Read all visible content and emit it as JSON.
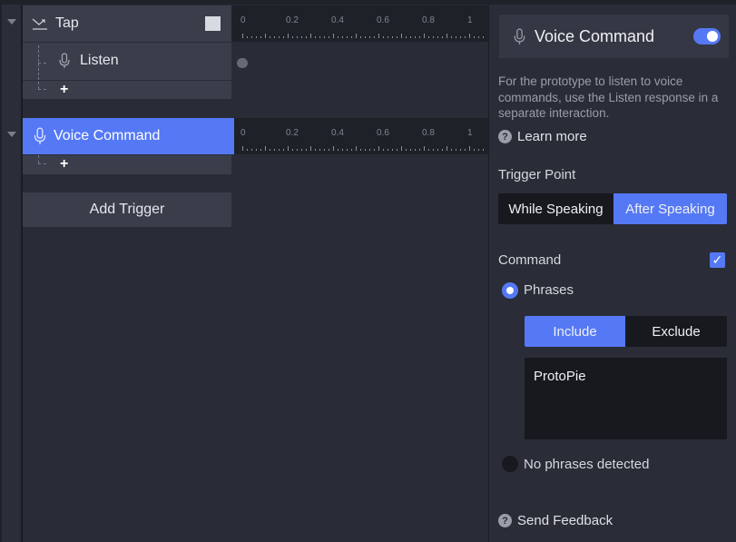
{
  "colors": {
    "accent": "#5579f5",
    "background": "#292b36",
    "row": "#3a3e4a",
    "dark": "#17191f"
  },
  "triggers": [
    {
      "label": "Tap",
      "icon": "tap-trigger-icon",
      "selected": false,
      "responses": [
        {
          "label": "Listen",
          "icon": "microphone-icon"
        }
      ],
      "add_response_label": "+"
    },
    {
      "label": "Voice Command",
      "icon": "microphone-icon",
      "selected": true,
      "responses": [],
      "add_response_label": "+"
    }
  ],
  "timeline": {
    "tick_labels": [
      "0",
      "0.2",
      "0.4",
      "0.6",
      "0.8",
      "1"
    ]
  },
  "add_trigger_label": "Add Trigger",
  "panel": {
    "title": "Voice Command",
    "enabled": true,
    "description": "For the prototype to listen to voice commands, use the Listen response in a separate interaction.",
    "learn_more": "Learn more",
    "trigger_point": {
      "label": "Trigger Point",
      "options": [
        "While Speaking",
        "After Speaking"
      ],
      "selected": "After Speaking"
    },
    "command": {
      "label": "Command",
      "checked": true,
      "phrases_label": "Phrases",
      "mode_options": [
        "Include",
        "Exclude"
      ],
      "mode_selected": "Include",
      "phrases_value": "ProtoPie",
      "no_phrases_label": "No phrases detected"
    },
    "send_feedback": "Send Feedback"
  }
}
